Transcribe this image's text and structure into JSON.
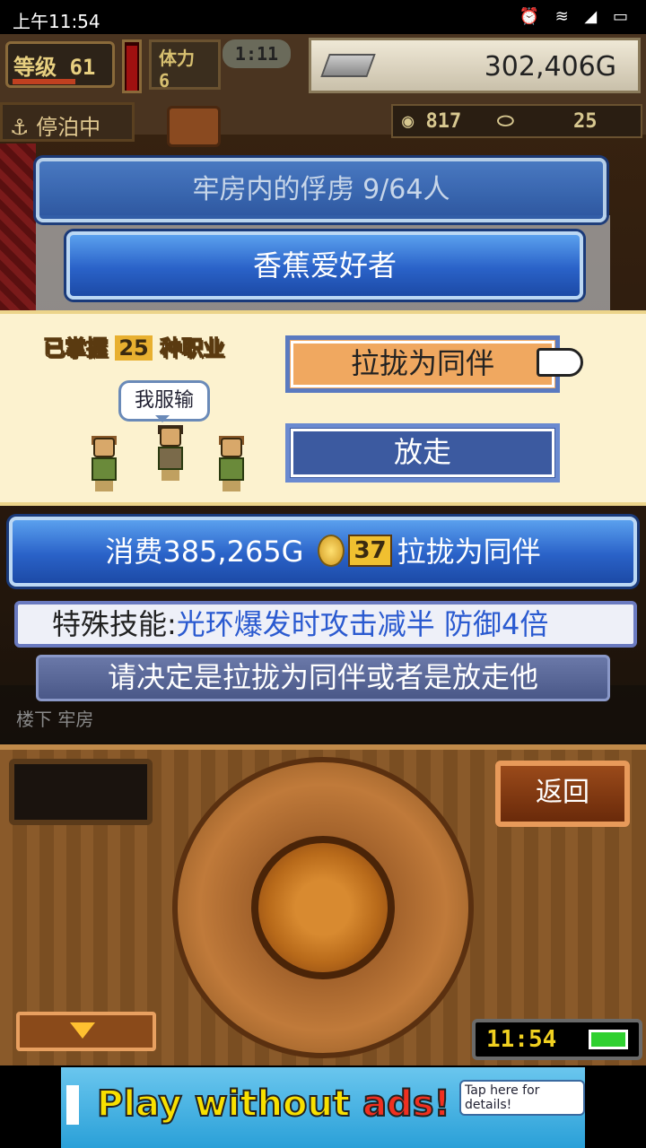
{
  "status_bar": {
    "time": "上午11:54",
    "icons": "⏰ ≋ ◢ ▭"
  },
  "hud": {
    "level_label": "等级",
    "level": "61",
    "stamina_label": "体力",
    "stamina": "6",
    "timer": "1:11",
    "gold": "302,406G",
    "dock_status": "停泊中",
    "res1": "817",
    "res2": "25"
  },
  "prison": {
    "title": "牢房内的俘虏  9/64人",
    "prisoner_name": "香蕉爱好者"
  },
  "dialog": {
    "mastered_prefix": "已掌握",
    "mastered_count": "25",
    "mastered_suffix": "种职业",
    "speech": "我服输",
    "recruit_label": "拉拢为同伴",
    "release_label": "放走"
  },
  "cost": {
    "prefix": "消费385,265G",
    "coins": "37",
    "suffix": "拉拢为同伴"
  },
  "skill": {
    "label": "特殊技能:",
    "value": "光环爆发时攻击减半 防御4倍"
  },
  "hint": "请决定是拉拢为同伴或者是放走他",
  "location": "楼下 牢房",
  "controls": {
    "back_label": "返回",
    "clock": "11:54"
  },
  "ad": {
    "part1": "Play without ",
    "part2": "ads!",
    "tap": "Tap here for details!"
  }
}
